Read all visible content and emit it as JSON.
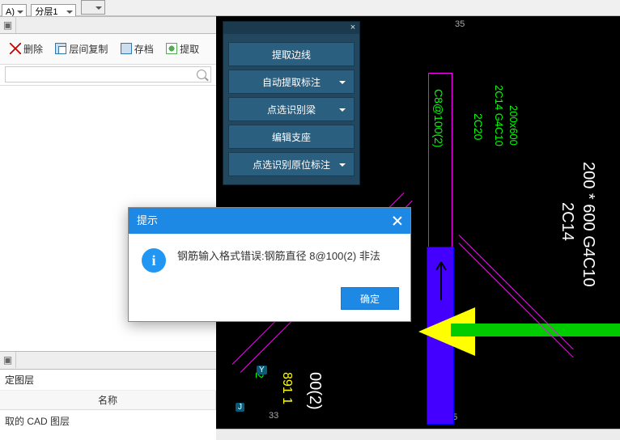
{
  "top_dropdowns": {
    "a": "A)",
    "b": "分层1",
    "c": ""
  },
  "toolbar": {
    "delete_label": "删除",
    "interfloor_copy_label": "层间复制",
    "archive_label": "存档",
    "extract_label": "提取"
  },
  "search": {
    "placeholder": ""
  },
  "layers_panel": {
    "specified_layer_title": "定图层",
    "col_name": "名称",
    "row0": "取的 CAD 图层"
  },
  "float_menu": {
    "btn_extract_edge": "提取边线",
    "btn_auto_annot": "自动提取标注",
    "btn_point_identify_beam": "点选识别梁",
    "btn_edit_support": "编辑支座",
    "btn_point_identify_origin": "点选识别原位标注"
  },
  "dialog": {
    "title": "提示",
    "message": "钢筋输入格式错误:钢筋直径 8@100(2) 非法",
    "ok_label": "确定"
  },
  "grid_numbers": {
    "top": "35",
    "bottom_left": "33",
    "bottom_right": "35"
  },
  "node_labels": {
    "y": "Y",
    "j": "J"
  },
  "cad_texts": {
    "c8_100_2": "C8@100(2)",
    "_2c20": "2C20",
    "_2c14_g4c10_a": "2C14 G4C10",
    "_200x600": "200x600",
    "_2c14": "2C14",
    "_200_600_g4c10": "200 * 600 G4C10",
    "_891_1": "891 1",
    "_00_2": "00(2)",
    "_2": "2"
  }
}
